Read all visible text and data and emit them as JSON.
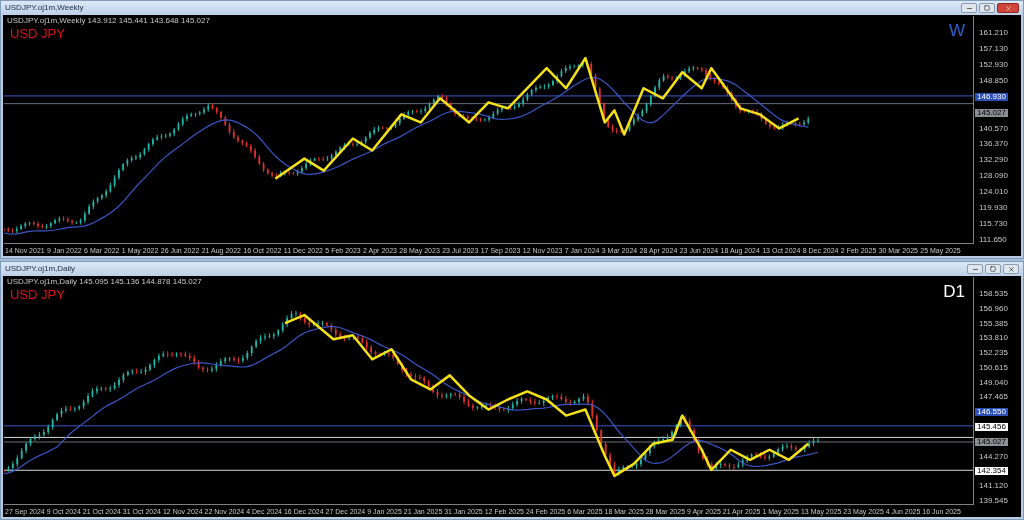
{
  "windows": [
    {
      "title": "USDJPY.oj1m,Weekly",
      "header": "USDJPY.oj1m,Weekly  143.912 145.441 143.648 145.027",
      "symbol_label": "USD JPY",
      "timeframe_label": "W",
      "close_highlighted": true,
      "price_ticks": [
        "161.210",
        "157.130",
        "152.930",
        "148.850",
        "140.570",
        "136.370",
        "132.290",
        "128.090",
        "124.010",
        "119.930",
        "115.730",
        "111.650"
      ],
      "price_tags": [
        {
          "value": "146.930",
          "kind": "line"
        },
        {
          "value": "145.027",
          "kind": "current"
        }
      ],
      "date_ticks": [
        "14 Nov 2021",
        "9 Jan 2022",
        "6 Mar 2022",
        "1 May 2022",
        "26 Jun 2022",
        "21 Aug 2022",
        "16 Oct 2022",
        "11 Dec 2022",
        "5 Feb 2023",
        "2 Apr 2023",
        "28 May 2023",
        "23 Jul 2023",
        "17 Sep 2023",
        "12 Nov 2023",
        "7 Jan 2024",
        "3 Mar 2024",
        "28 Apr 2024",
        "23 Jun 2024",
        "18 Aug 2024",
        "13 Oct 2024",
        "8 Dec 2024",
        "2 Feb 2025",
        "30 Mar 2025",
        "25 May 2025"
      ]
    },
    {
      "title": "USDJPY.oj1m,Daily",
      "header": "USDJPY.oj1m,Daily  145.095 145.136 144.878 145.027",
      "symbol_label": "USD JPY",
      "timeframe_label": "D1",
      "close_highlighted": false,
      "price_ticks": [
        "158.535",
        "156.960",
        "155.385",
        "153.810",
        "152.235",
        "150.615",
        "149.040",
        "147.465",
        "144.270",
        "141.120",
        "139.545"
      ],
      "price_tags": [
        {
          "value": "146.550",
          "kind": "line"
        },
        {
          "value": "145.456",
          "kind": "level"
        },
        {
          "value": "145.027",
          "kind": "current"
        },
        {
          "value": "142.354",
          "kind": "level"
        }
      ],
      "date_ticks": [
        "27 Sep 2024",
        "9 Oct 2024",
        "21 Oct 2024",
        "31 Oct 2024",
        "12 Nov 2024",
        "22 Nov 2024",
        "4 Dec 2024",
        "16 Dec 2024",
        "27 Dec 2024",
        "9 Jan 2025",
        "21 Jan 2025",
        "31 Jan 2025",
        "12 Feb 2025",
        "24 Feb 2025",
        "6 Mar 2025",
        "18 Mar 2025",
        "28 Mar 2025",
        "9 Apr 2025",
        "21 Apr 2025",
        "1 May 2025",
        "13 May 2025",
        "23 May 2025",
        "4 Jun 2025",
        "16 Jun 2025"
      ]
    }
  ]
}
